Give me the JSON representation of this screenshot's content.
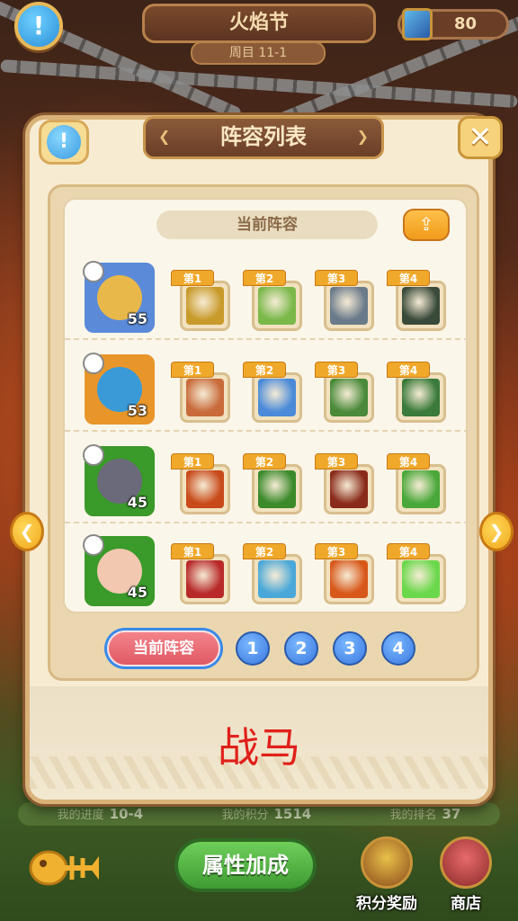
{
  "topbar": {
    "title": "火焰节",
    "subtitle": "周目 11-1",
    "currency_value": "80",
    "help_label": "!"
  },
  "modal": {
    "title": "阵容列表",
    "help_label": "!",
    "close_label": "✕",
    "current_lineup_label": "当前阵容",
    "share_label": "⇪",
    "footer_text": "战马",
    "teams": [
      {
        "level": "55",
        "frame_color": "#5a8ad8",
        "face_color": "#e8b84a",
        "skills": [
          {
            "tag": "第1",
            "color": "#c89a2a"
          },
          {
            "tag": "第2",
            "color": "#7ab84a"
          },
          {
            "tag": "第3",
            "color": "#6a7a8a"
          },
          {
            "tag": "第4",
            "color": "#3a4a3a"
          }
        ]
      },
      {
        "level": "53",
        "frame_color": "#e8962a",
        "face_color": "#3a9ad8",
        "skills": [
          {
            "tag": "第1",
            "color": "#c86a3a"
          },
          {
            "tag": "第2",
            "color": "#4a8ad8"
          },
          {
            "tag": "第3",
            "color": "#4a8a3a"
          },
          {
            "tag": "第4",
            "color": "#3a7a3a"
          }
        ]
      },
      {
        "level": "45",
        "frame_color": "#3a9a2a",
        "face_color": "#6a6a7a",
        "skills": [
          {
            "tag": "第1",
            "color": "#c84a1a"
          },
          {
            "tag": "第2",
            "color": "#3a8a2a"
          },
          {
            "tag": "第3",
            "color": "#8a2a1a"
          },
          {
            "tag": "第4",
            "color": "#4aa83a"
          }
        ]
      },
      {
        "level": "45",
        "frame_color": "#3a9a2a",
        "face_color": "#f2c8b0",
        "skills": [
          {
            "tag": "第1",
            "color": "#b82a2a"
          },
          {
            "tag": "第2",
            "color": "#4aa8d8"
          },
          {
            "tag": "第3",
            "color": "#d8581a"
          },
          {
            "tag": "第4",
            "color": "#6ad84a"
          }
        ]
      }
    ],
    "selector": {
      "current_label": "当前阵容",
      "numbers": [
        "1",
        "2",
        "3",
        "4"
      ]
    }
  },
  "bottom": {
    "stats": [
      {
        "label": "我的进度",
        "value": "10-4"
      },
      {
        "label": "我的积分",
        "value": "1514"
      },
      {
        "label": "我的排名",
        "value": "37"
      }
    ],
    "attr_button": "属性加成",
    "points_reward_label": "积分奖励",
    "shop_label": "商店"
  },
  "icons": {
    "prev_arrow": "❮",
    "next_arrow": "❯"
  }
}
